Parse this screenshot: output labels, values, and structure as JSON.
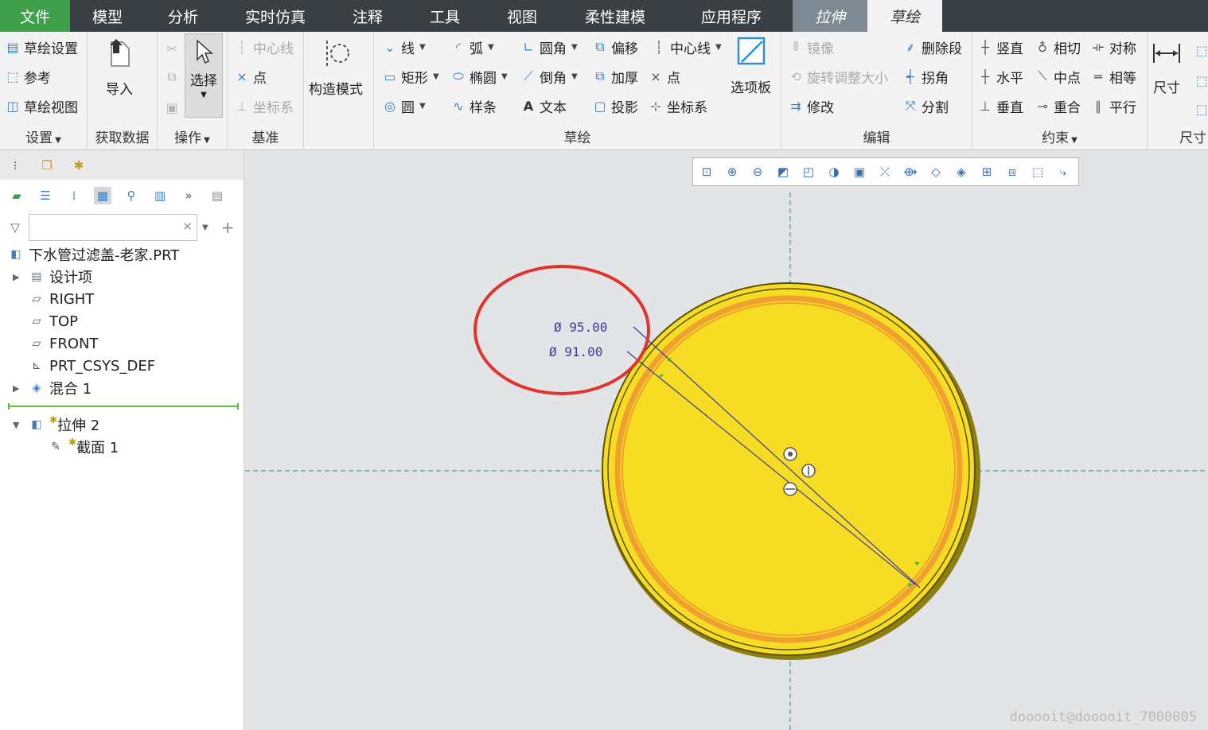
{
  "tabs": [
    {
      "label": "文件"
    },
    {
      "label": "模型"
    },
    {
      "label": "分析"
    },
    {
      "label": "实时仿真"
    },
    {
      "label": "注释"
    },
    {
      "label": "工具"
    },
    {
      "label": "视图"
    },
    {
      "label": "柔性建模"
    },
    {
      "label": "应用程序"
    },
    {
      "label": "拉伸"
    },
    {
      "label": "草绘"
    }
  ],
  "ribbon": {
    "settings": {
      "title": "设置",
      "items": [
        "草绘设置",
        "参考",
        "草绘视图"
      ]
    },
    "getdata": {
      "title": "获取数据",
      "import": "导入"
    },
    "operations": {
      "title": "操作",
      "select": "选择"
    },
    "datum": {
      "title": "基准",
      "items": [
        "中心线",
        "点",
        "坐标系"
      ]
    },
    "construct": {
      "label": "构造模式"
    },
    "sketch": {
      "title": "草绘",
      "col1": [
        "线",
        "矩形",
        "圆"
      ],
      "col2": [
        "弧",
        "椭圆",
        "样条"
      ],
      "col3": [
        "圆角",
        "倒角",
        "文本"
      ],
      "col4": [
        "偏移",
        "加厚",
        "投影"
      ],
      "col5": [
        "中心线",
        "点",
        "坐标系"
      ],
      "palette": "选项板"
    },
    "edit": {
      "title": "编辑",
      "col1": [
        "镜像",
        "旋转调整大小",
        "修改"
      ],
      "col2": [
        "删除段",
        "拐角",
        "分割"
      ]
    },
    "constraints": {
      "title": "约束",
      "col1": [
        "竖直",
        "水平",
        "垂直"
      ],
      "col2": [
        "相切",
        "中点",
        "重合"
      ],
      "col3": [
        "对称",
        "相等",
        "平行"
      ]
    },
    "dimension": {
      "title": "尺寸",
      "label": "尺寸"
    }
  },
  "tree": {
    "root": "下水管过滤盖-老家.PRT",
    "nodes": [
      "设计项",
      "RIGHT",
      "TOP",
      "FRONT",
      "PRT_CSYS_DEF",
      "混合 1",
      "拉伸 2",
      "截面 1"
    ]
  },
  "canvas": {
    "dim1": "Ø 95.00",
    "dim2": "Ø 91.00",
    "watermark": "dooooit@dooooit_7000005"
  },
  "colors": {
    "file_tab": "#3ea04a",
    "part_fill": "#f7dc24",
    "part_edge": "#9a8a10",
    "highlight_ring": "#f0a030",
    "annotation_circle": "#e2342f"
  }
}
